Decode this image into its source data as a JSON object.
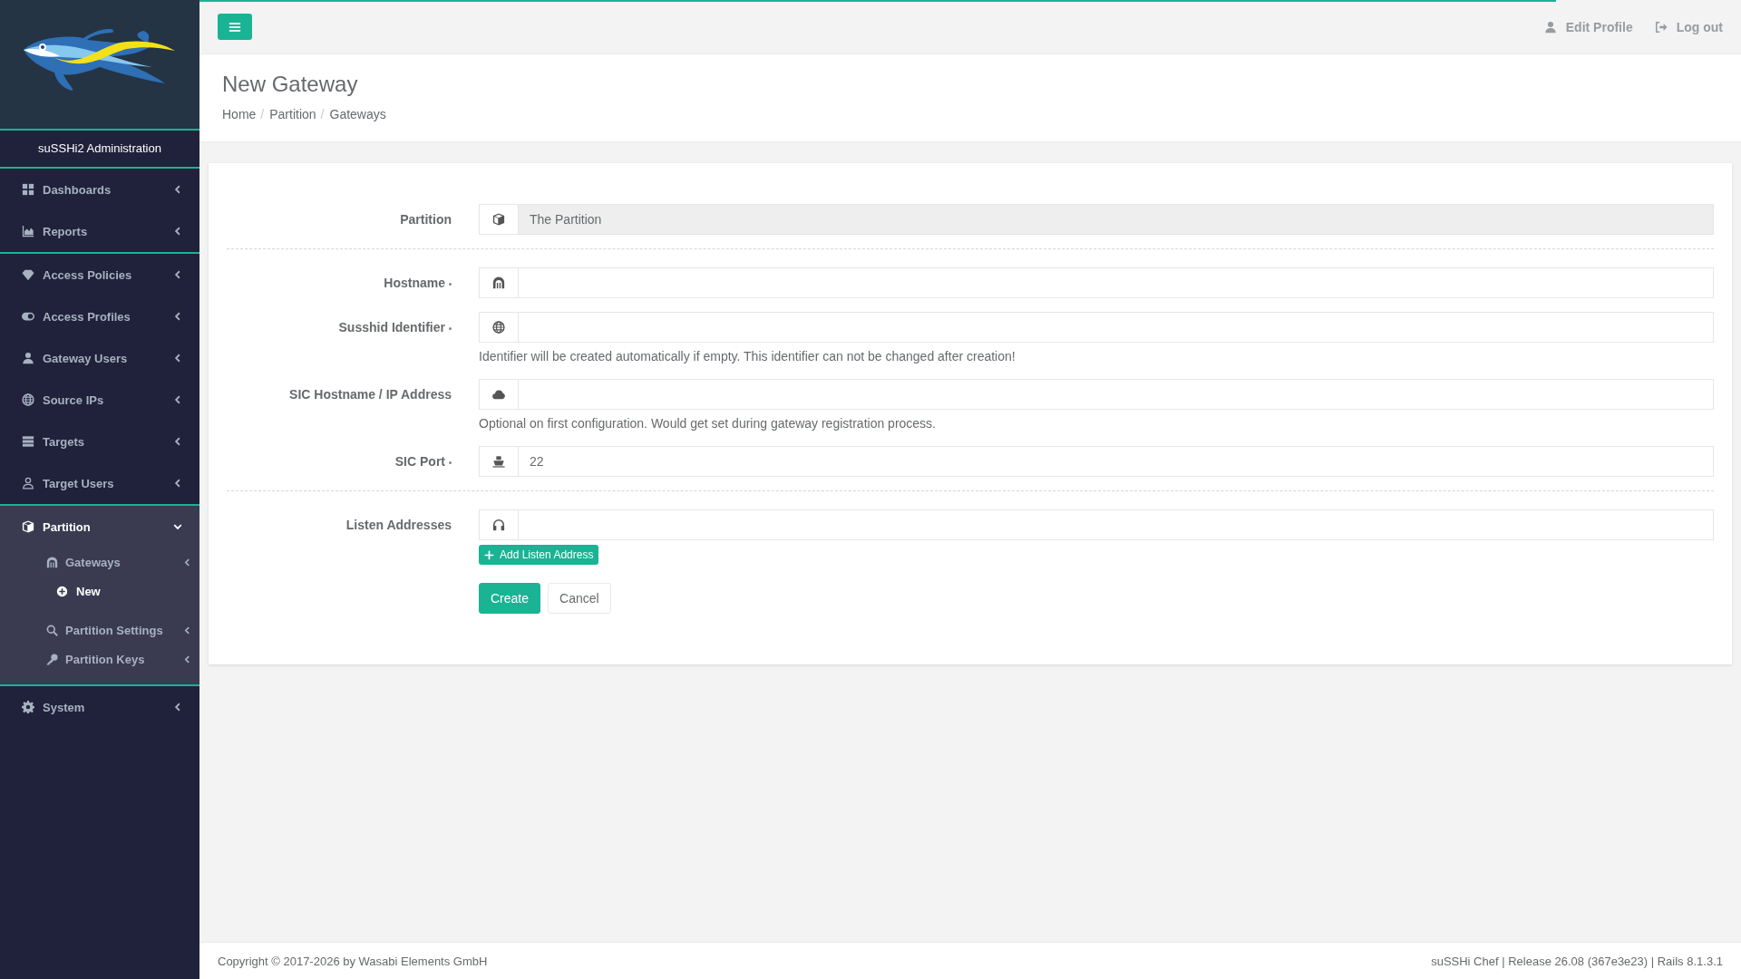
{
  "progress": {
    "level": 0.88
  },
  "topbar": {
    "links": [
      {
        "label": "Edit Profile"
      },
      {
        "label": "Log out"
      }
    ]
  },
  "sidebar": {
    "brand": "suSSHi2 Administration",
    "groups": [
      {
        "items": [
          {
            "label": "Dashboards",
            "selected": false,
            "expanded": false
          },
          {
            "label": "Reports",
            "selected": false,
            "expanded": false
          }
        ]
      },
      {
        "items": [
          {
            "label": "Access Policies",
            "selected": false,
            "expanded": false
          },
          {
            "label": "Access Profiles",
            "selected": false,
            "expanded": false
          },
          {
            "label": "Gateway Users",
            "selected": false,
            "expanded": false
          },
          {
            "label": "Source IPs",
            "selected": false,
            "expanded": false
          },
          {
            "label": "Targets",
            "selected": false,
            "expanded": false
          },
          {
            "label": "Target Users",
            "selected": false,
            "expanded": false
          }
        ]
      },
      {
        "items": [
          {
            "label": "Partition",
            "selected": true,
            "expanded": true,
            "children": [
              {
                "label": "Gateways",
                "selected": false,
                "children": [
                  {
                    "label": "New",
                    "selected": true
                  }
                ]
              },
              {
                "label": "Partition Settings",
                "selected": false
              },
              {
                "label": "Partition Keys",
                "selected": false
              }
            ]
          }
        ]
      },
      {
        "items": [
          {
            "label": "System",
            "selected": false,
            "expanded": false
          }
        ]
      }
    ]
  },
  "header": {
    "title": "New Gateway",
    "breadcrumb": {
      "separator": "/",
      "items": [
        "Home",
        "Partition",
        "Gateways"
      ]
    }
  },
  "form": {
    "sections": [
      {
        "fields": [
          {
            "label": "Partition",
            "required": false,
            "disabled": true,
            "value": "The Partition"
          }
        ]
      },
      {
        "fields": [
          {
            "label": "Hostname",
            "required": true,
            "disabled": false
          },
          {
            "label": "Susshid Identifier",
            "required": true,
            "disabled": false,
            "help": "Identifier will be created automatically if empty. This identifier can not be changed after creation!"
          },
          {
            "label": "SIC Hostname / IP Address",
            "required": false,
            "disabled": false,
            "help": "Optional on first configuration. Would get set during gateway registration process."
          },
          {
            "label": "SIC Port",
            "required": true,
            "disabled": false,
            "value": "22"
          }
        ]
      },
      {
        "fields": [
          {
            "label": "Listen Addresses",
            "required": false,
            "disabled": false,
            "add_button": "Add Listen Address"
          }
        ]
      }
    ],
    "actions": [
      {
        "label": "Create",
        "kind": "primary"
      },
      {
        "label": "Cancel",
        "kind": "default"
      }
    ]
  },
  "footer": {
    "copyright": "Copyright © 2017-2026 by Wasabi Elements GmbH",
    "version": "suSSHi Chef | Release 26.08 (367e3e23) | Rails 8.1.3.1"
  }
}
